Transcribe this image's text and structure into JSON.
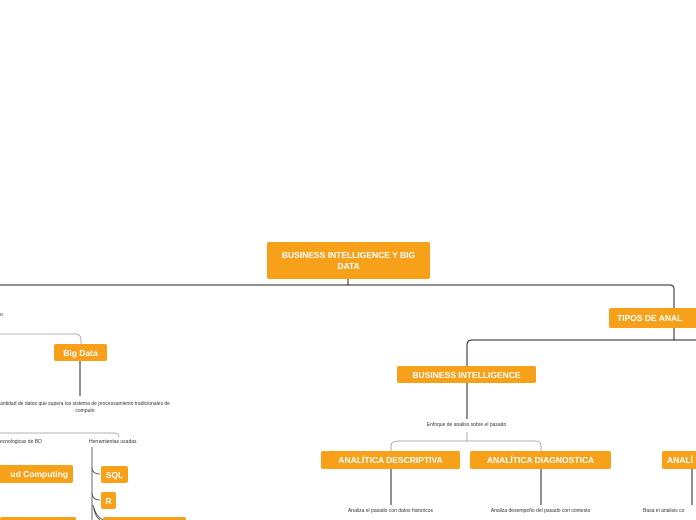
{
  "root": {
    "title": "BUSINESS INTELLIGENCE Y BIG DATA"
  },
  "branches": {
    "tipos": {
      "title": "TIPOS DE ANAL"
    },
    "big_data": {
      "title": "Big Data",
      "top_label": "o",
      "definition": "antidad de datos que supera los sistema de processamiento tradicionales de computo",
      "tecnologias_label": "ecnologicas de BD",
      "herramientas_label": "Herramientas usadas",
      "cloud": "ud Computing",
      "tools": [
        "SQL",
        "R"
      ]
    },
    "business_intelligence": {
      "title": "BUSINESS INTELLIGENCE",
      "subtitle": "Enfoque de analiss sobre el pasado",
      "descriptiva": {
        "title": "ANALÍTICA DESCRIPTIVA",
        "text": "Analiza el pasado con datos historicos"
      },
      "diagnostica": {
        "title": "ANALÍTICA DIAGNOSTICA",
        "text": "Analiza desempeño del pasado con contesto"
      }
    },
    "right_partial": {
      "title": "ANALÍ",
      "text": "Basa el analisis co"
    }
  },
  "colors": {
    "node": "#f7a11a",
    "line": "#222222",
    "soft_line": "#9a9a9a"
  }
}
